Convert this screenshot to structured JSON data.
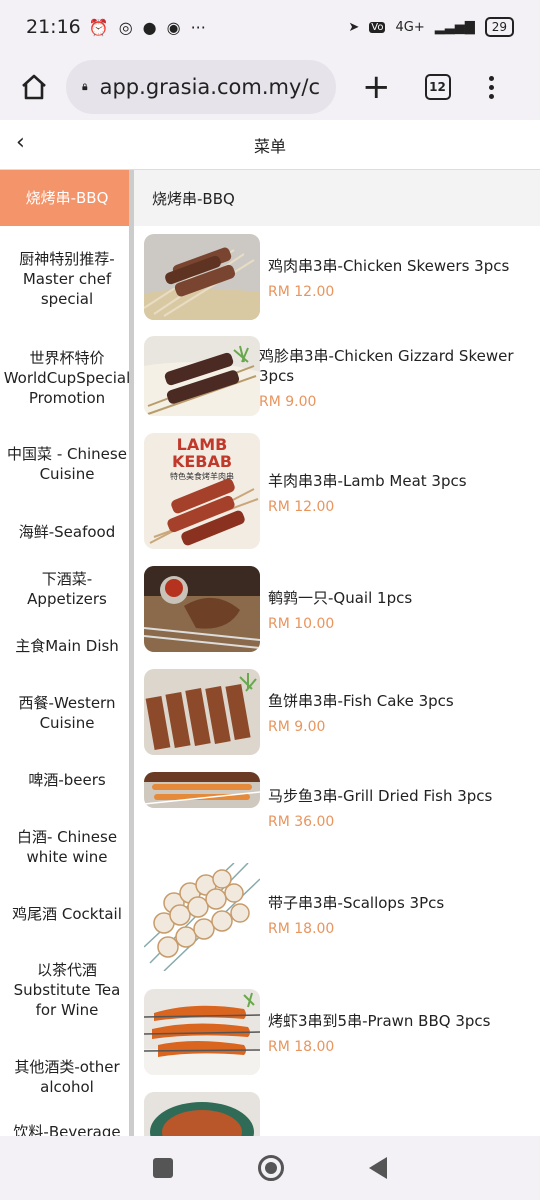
{
  "status_bar": {
    "time": "21:16",
    "more": "···",
    "network": "4G+",
    "battery": "29"
  },
  "browser": {
    "url": "app.grasia.com.my/c",
    "tab_count": "12"
  },
  "header": {
    "back": "‹",
    "title": "菜单"
  },
  "sidebar": {
    "items": [
      {
        "label": "烧烤串-BBQ",
        "active": true
      },
      {
        "label": "厨神特别推荐-Master chef special"
      },
      {
        "label": "世界杯特价 WorldCupSpecial Promotion"
      },
      {
        "label": "中国菜 - Chinese Cuisine"
      },
      {
        "label": "海鲜-Seafood"
      },
      {
        "label": "下酒菜-Appetizers"
      },
      {
        "label": "主食Main Dish"
      },
      {
        "label": "西餐-Western Cuisine"
      },
      {
        "label": "啤酒-beers"
      },
      {
        "label": "白酒- Chinese white wine"
      },
      {
        "label": "鸡尾酒 Cocktail"
      },
      {
        "label": "以茶代酒 Substitute Tea for Wine"
      },
      {
        "label": "其他酒类-other alcohol"
      },
      {
        "label": "饮料-Beverage"
      }
    ]
  },
  "main": {
    "section_title": "烧烤串-BBQ",
    "items": [
      {
        "name": "鸡肉串3串-Chicken Skewers 3pcs",
        "price": "RM 12.00"
      },
      {
        "name": "鸡胗串3串-Chicken Gizzard Skewer 3pcs",
        "price": "RM 9.00"
      },
      {
        "name": "羊肉串3串-Lamb Meat 3pcs",
        "price": "RM 12.00",
        "image_text": [
          "LAMB",
          "KEBAB",
          "特色美食烤羊肉串"
        ]
      },
      {
        "name": "鹌鹑一只-Quail 1pcs",
        "price": "RM 10.00"
      },
      {
        "name": "鱼饼串3串-Fish Cake 3pcs",
        "price": "RM 9.00"
      },
      {
        "name": "马步鱼3串-Grill Dried Fish 3pcs",
        "price": "RM 36.00"
      },
      {
        "name": "带子串3串-Scallops 3Pcs",
        "price": "RM 18.00"
      },
      {
        "name": "烤虾3串到5串-Prawn BBQ 3pcs",
        "price": "RM 18.00"
      }
    ]
  },
  "colors": {
    "accent": "#f3946a",
    "price": "#e8955e"
  }
}
